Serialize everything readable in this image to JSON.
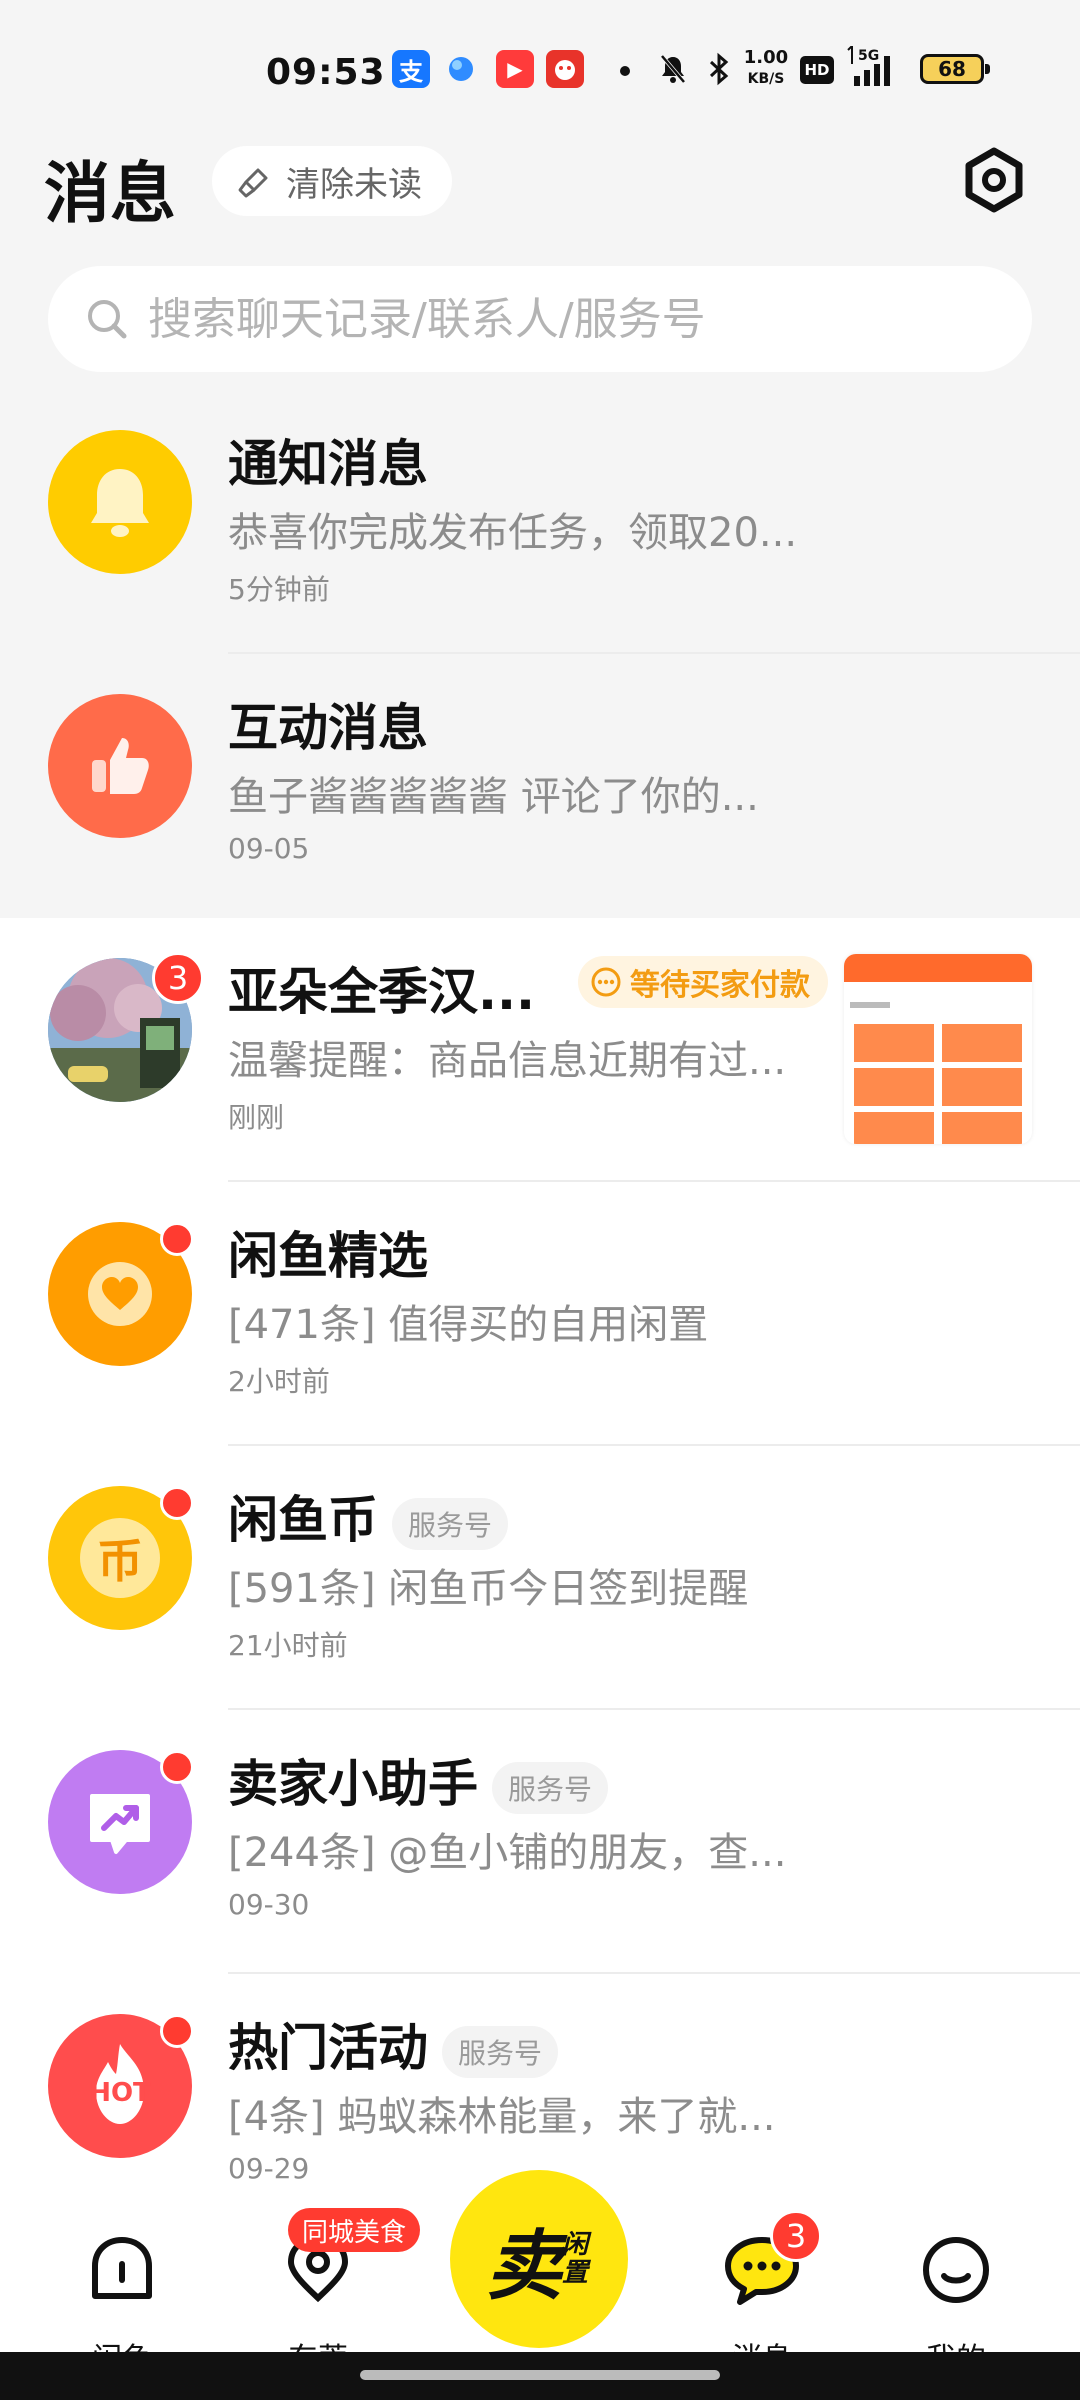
{
  "status_bar": {
    "time": "09:53",
    "app_icons": [
      {
        "name": "alipay-app-icon",
        "glyph": "支",
        "color": "#1677ff"
      },
      {
        "name": "browser-app-icon",
        "glyph": "",
        "color": "#2f8cff"
      },
      {
        "name": "video-app-icon",
        "glyph": "▶",
        "color": "#ff3b3b"
      },
      {
        "name": "game-app-icon",
        "glyph": "",
        "color": "#e8332a"
      }
    ],
    "network_speed": "1.00",
    "network_unit": "KB/S",
    "hd_label": "HD",
    "network_type": "5G",
    "battery": "68"
  },
  "header": {
    "title": "消息",
    "clear_unread_label": "清除未读"
  },
  "search": {
    "placeholder": "搜索聊天记录/联系人/服务号"
  },
  "conversations": [
    {
      "name": "通知消息",
      "preview": "恭喜你完成发布任务，领取20...",
      "time": "5分钟前",
      "avatar_color": "#ffcc00",
      "icon": "bell-icon"
    },
    {
      "name": "互动消息",
      "preview": "鱼子酱酱酱酱酱 评论了你的...",
      "time": "09-05",
      "avatar_color": "#ff6b4a",
      "icon": "thumbs-up-icon"
    },
    {
      "name": "亚朵全季汉...",
      "status": "等待买家付款",
      "preview": "温馨提醒：商品信息近期有过...",
      "time": "刚刚",
      "badge": "3",
      "icon": "user-photo-avatar"
    },
    {
      "name": "闲鱼精选",
      "preview": "[471条] 值得买的自用闲置",
      "time": "2小时前",
      "avatar_color": "#ff9d00",
      "icon": "heart-icon"
    },
    {
      "name": "闲鱼币",
      "tag": "服务号",
      "preview": "[591条] 闲鱼币今日签到提醒",
      "time": "21小时前",
      "avatar_color": "#ffc60a",
      "icon_text": "币",
      "icon": "coin-icon"
    },
    {
      "name": "卖家小助手",
      "tag": "服务号",
      "preview": "[244条] @鱼小铺的朋友，查...",
      "time": "09-30",
      "avatar_color": "#c07cf2",
      "icon": "trending-up-icon"
    },
    {
      "name": "热门活动",
      "tag": "服务号",
      "preview": "[4条] 蚂蚁森林能量，来了就...",
      "time": "09-29",
      "avatar_color": "#ff4d4d",
      "icon_text": "HOT",
      "icon": "hot-fire-icon"
    }
  ],
  "bottom_nav": {
    "home": "闲鱼",
    "city": "东莞",
    "city_tag": "同城美食",
    "sell_main": "卖",
    "sell_sub": "闲置",
    "messages": "消息",
    "messages_badge": "3",
    "mine": "我的"
  }
}
